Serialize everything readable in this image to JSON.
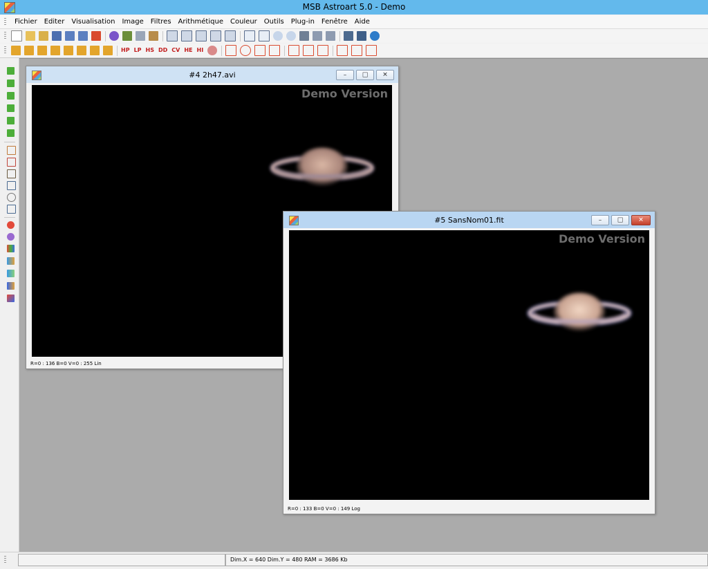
{
  "app": {
    "title": "MSB Astroart 5.0 - Demo"
  },
  "menu": [
    "Fichier",
    "Editer",
    "Visualisation",
    "Image",
    "Filtres",
    "Arithmétique",
    "Couleur",
    "Outils",
    "Plug-in",
    "Fenêtre",
    "Aide"
  ],
  "toolbar2_text_buttons": [
    "HP",
    "LP",
    "HS",
    "DD",
    "CV",
    "HE",
    "HI"
  ],
  "windows": {
    "avi": {
      "title": "#4 2h47.avi",
      "watermark": "Demo Version",
      "status": "R=0 : 136   B=0   V=0 : 255 Lin"
    },
    "fit": {
      "title": "#5 SansNom01.fit",
      "watermark": "Demo Version",
      "status": "R=0 : 133   B=0   V=0 : 149 Log"
    }
  },
  "statusbar": {
    "info": "Dim.X = 640   Dim.Y = 480   RAM = 3686 Kb"
  },
  "colors": {
    "titlebar": "#63b9ec",
    "mdi_background": "#ababab",
    "image_background": "#000000"
  }
}
